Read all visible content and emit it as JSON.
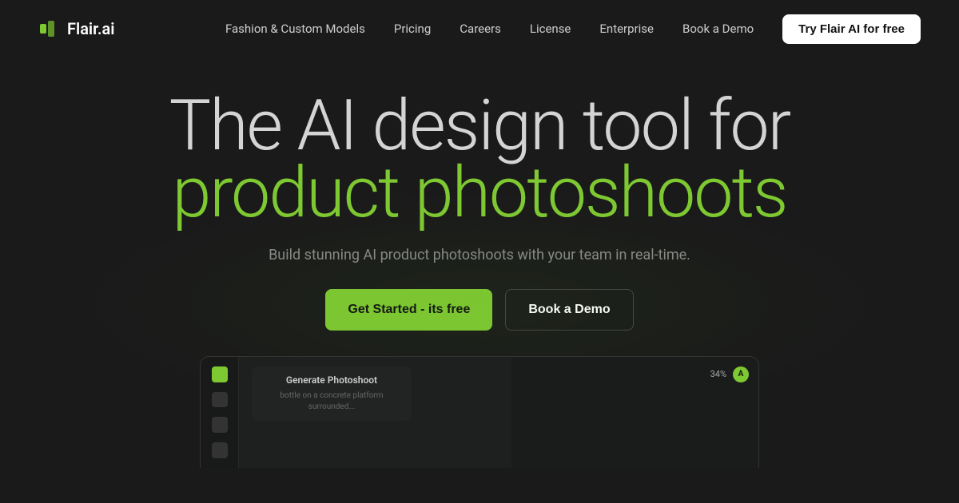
{
  "navbar": {
    "logo_text": "Flair.ai",
    "links": [
      {
        "label": "Fashion & Custom Models",
        "key": "fashion-custom-models"
      },
      {
        "label": "Pricing",
        "key": "pricing"
      },
      {
        "label": "Careers",
        "key": "careers"
      },
      {
        "label": "License",
        "key": "license"
      },
      {
        "label": "Enterprise",
        "key": "enterprise"
      },
      {
        "label": "Book a Demo",
        "key": "book-demo-nav"
      }
    ],
    "cta_label": "Try Flair AI for free"
  },
  "hero": {
    "title_line1": "The AI design tool for",
    "title_line2": "product photoshoots",
    "subtitle": "Build stunning AI product photoshoots with your team in real-time.",
    "btn_primary": "Get Started - its free",
    "btn_secondary": "Book a Demo"
  },
  "app_preview": {
    "panel_title": "Generate Photoshoot",
    "panel_text": "bottle on a concrete platform surrounded...",
    "toolbar_pct": "34%",
    "toolbar_badge": "A"
  },
  "colors": {
    "bg": "#1a1a1a",
    "green": "#7ec832",
    "white": "#ffffff",
    "nav_text": "#cccccc"
  }
}
